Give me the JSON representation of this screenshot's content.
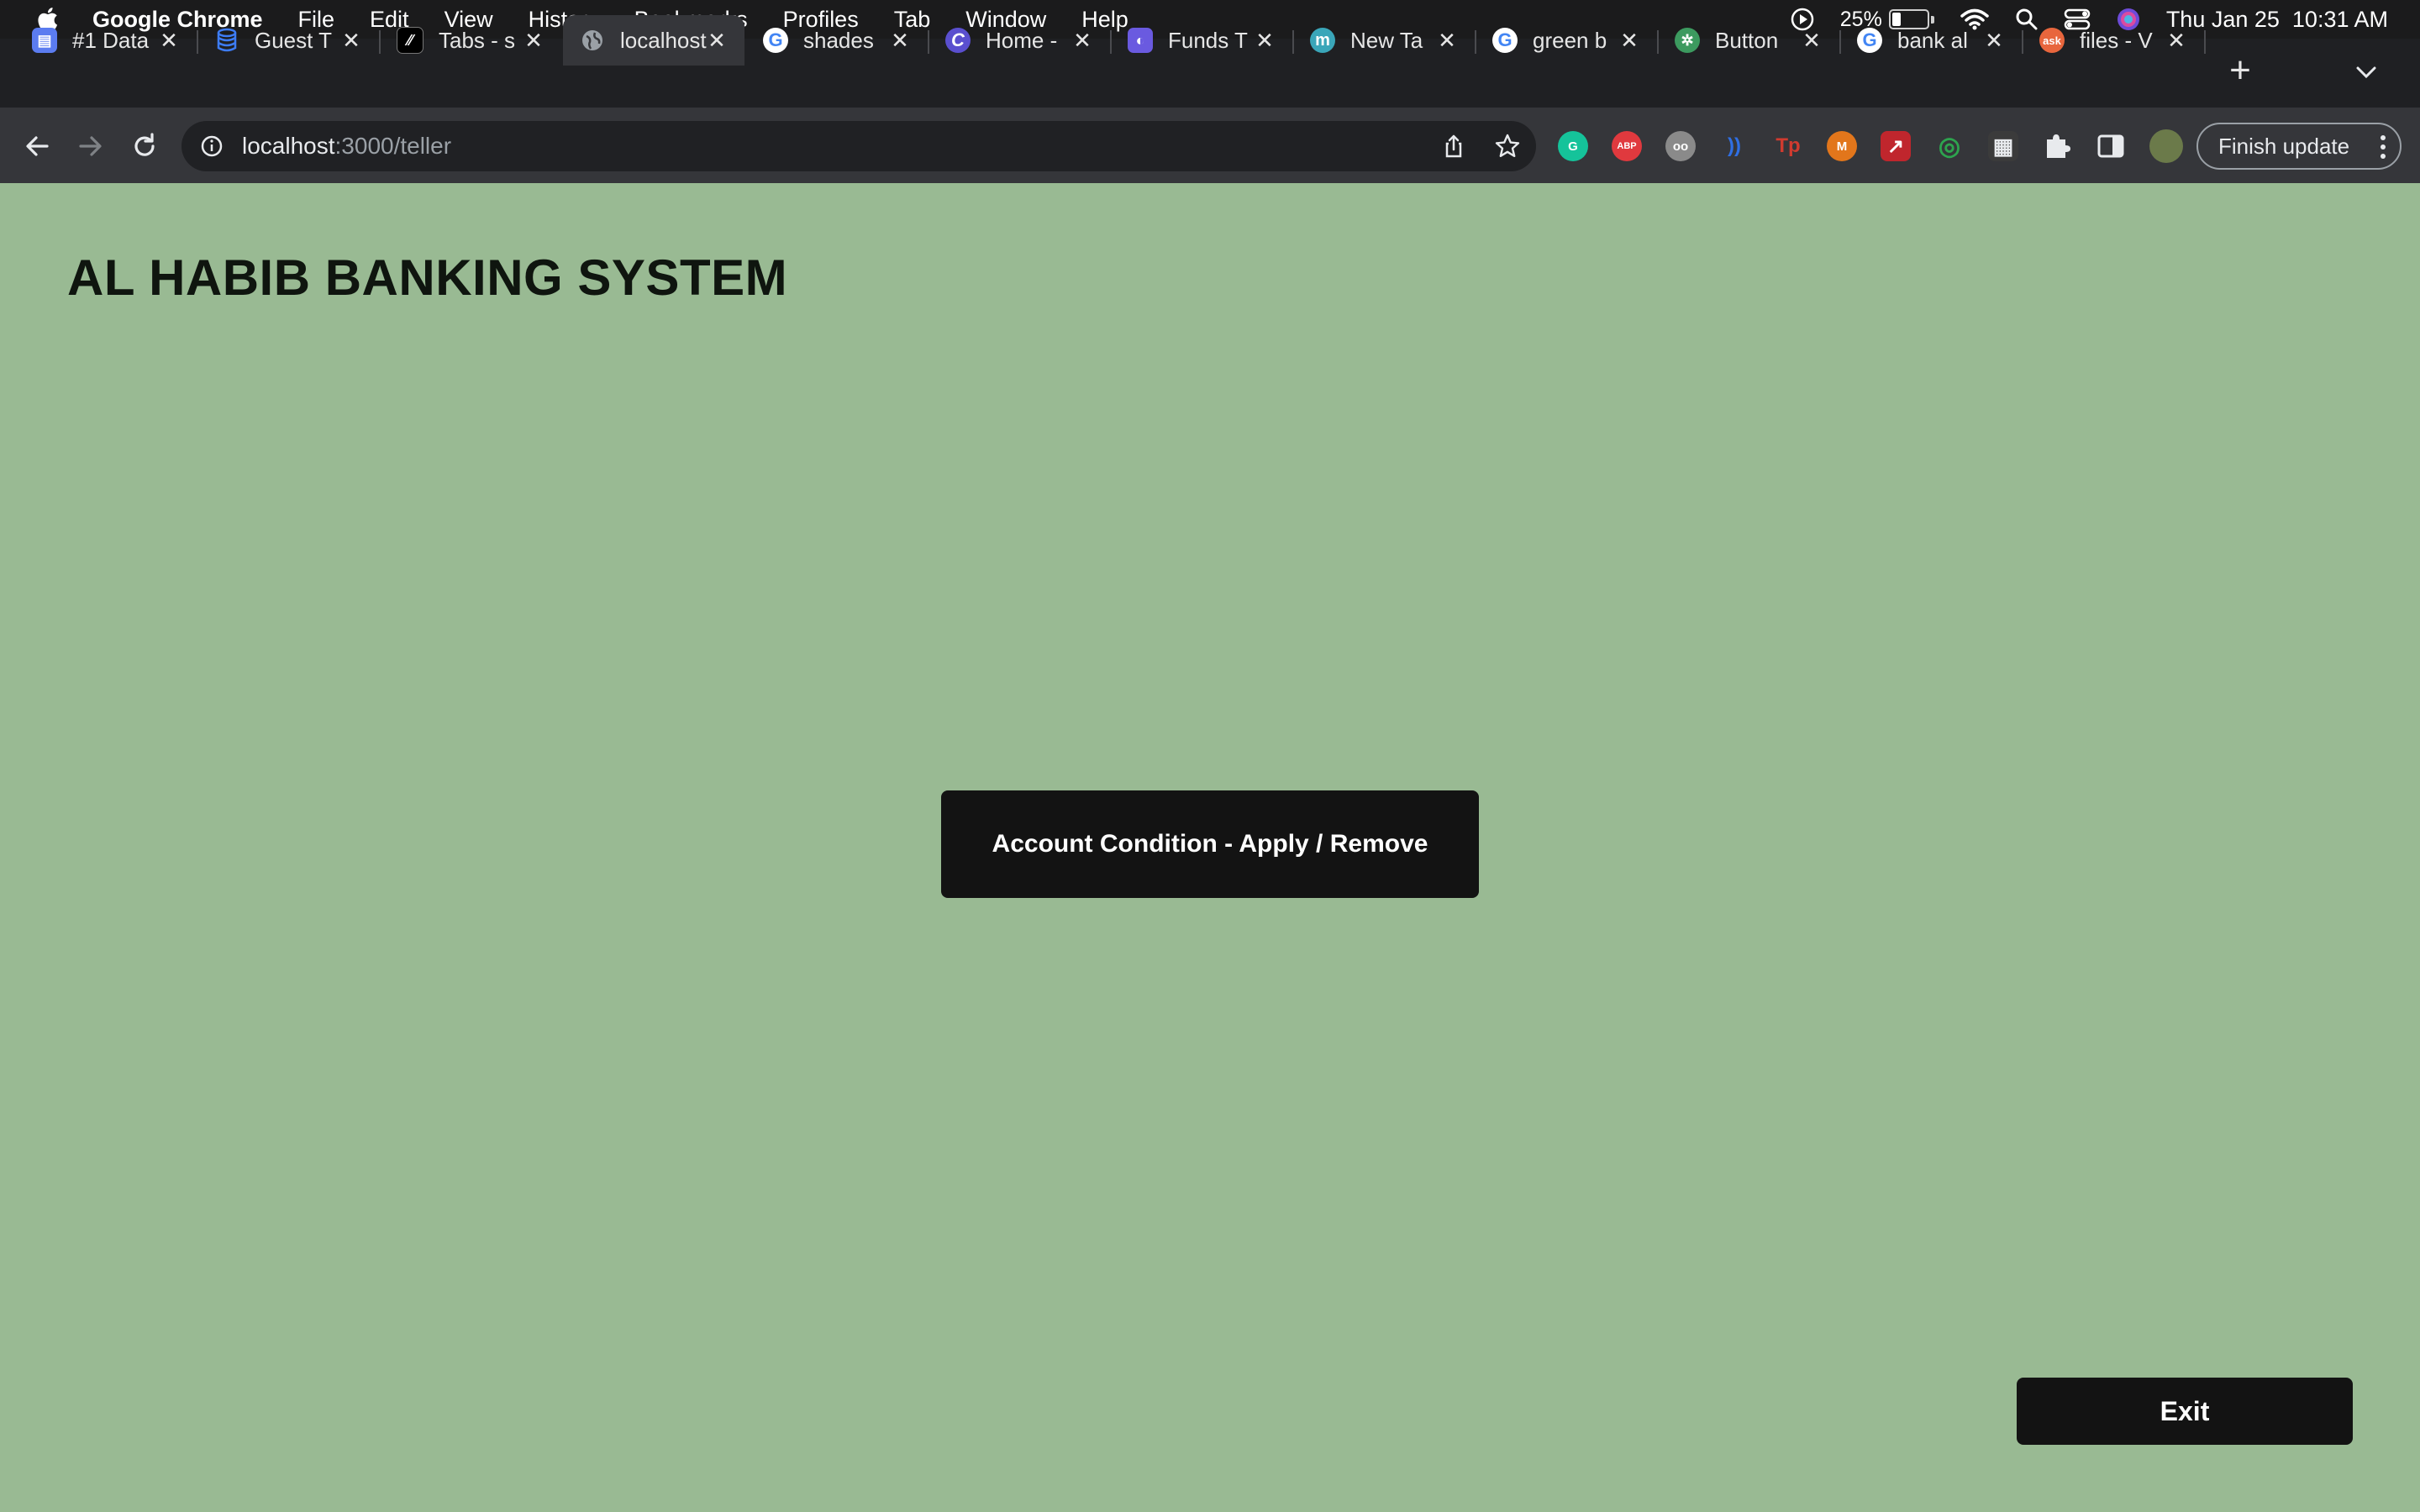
{
  "menubar": {
    "app_name": "Google Chrome",
    "items": [
      "File",
      "Edit",
      "View",
      "History",
      "Bookmarks",
      "Profiles",
      "Tab",
      "Window",
      "Help"
    ],
    "battery_percent": "25%",
    "battery_level": 0.25,
    "datetime": "Thu Jan 25  10:31 AM"
  },
  "tabs": [
    {
      "title": "#1 Data",
      "icon": "document-icon",
      "color": "#5b7cf0"
    },
    {
      "title": "Guest T",
      "icon": "database-icon",
      "color": "#3d7cf5"
    },
    {
      "title": "Tabs - s",
      "icon": "shadcn-icon",
      "color": "#000000"
    },
    {
      "title": "localhost",
      "icon": "globe-icon",
      "color": "#9aa0a6",
      "active": true
    },
    {
      "title": "shades",
      "icon": "google-icon",
      "color": "#ffffff"
    },
    {
      "title": "Home -",
      "icon": "c-logo-icon",
      "color": "#5a4fcf"
    },
    {
      "title": "Funds T",
      "icon": "funds-icon",
      "color": "#6a5ae0"
    },
    {
      "title": "New Ta",
      "icon": "m-logo-icon",
      "color": "#3aa6b9"
    },
    {
      "title": "green b",
      "icon": "google-icon",
      "color": "#ffffff"
    },
    {
      "title": "Button",
      "icon": "button-site-icon",
      "color": "#3c9a5f"
    },
    {
      "title": "bank al",
      "icon": "google-icon",
      "color": "#ffffff"
    },
    {
      "title": "files - V",
      "icon": "ask-icon",
      "color": "#e8663d"
    }
  ],
  "address": {
    "host": "localhost",
    "path": ":3000/teller"
  },
  "extensions": [
    {
      "name": "grammarly-icon",
      "label": "G",
      "color": "#15c39a"
    },
    {
      "name": "adblock-icon",
      "label": "ABP",
      "color": "#e0393e"
    },
    {
      "name": "glasses-icon",
      "label": "oo",
      "color": "#8a8a8a"
    },
    {
      "name": "wave-icon",
      "label": "))",
      "color": "#2f6fe4"
    },
    {
      "name": "tp-icon",
      "label": "Tp",
      "color": "#d13b2f"
    },
    {
      "name": "metamask-icon",
      "label": "M",
      "color": "#e2761b"
    },
    {
      "name": "arrow-ext-icon",
      "label": "↗",
      "color": "#c0262d"
    },
    {
      "name": "target-ext-icon",
      "label": "◎",
      "color": "#2da44e"
    },
    {
      "name": "grid-ext-icon",
      "label": "▦",
      "color": "#3b3b3b"
    },
    {
      "name": "puzzle-icon",
      "label": "",
      "color": "#35363a"
    },
    {
      "name": "sidepanel-icon",
      "label": "",
      "color": "#35363a"
    },
    {
      "name": "profile-avatar-icon",
      "label": "",
      "color": "#6b7a4a"
    }
  ],
  "update_button": "Finish update",
  "page": {
    "title": "AL HABIB BANKING SYSTEM",
    "condition_button": "Account Condition - Apply / Remove",
    "exit_button": "Exit"
  },
  "colors": {
    "page_background": "#99ba93",
    "button_background": "#131313"
  }
}
